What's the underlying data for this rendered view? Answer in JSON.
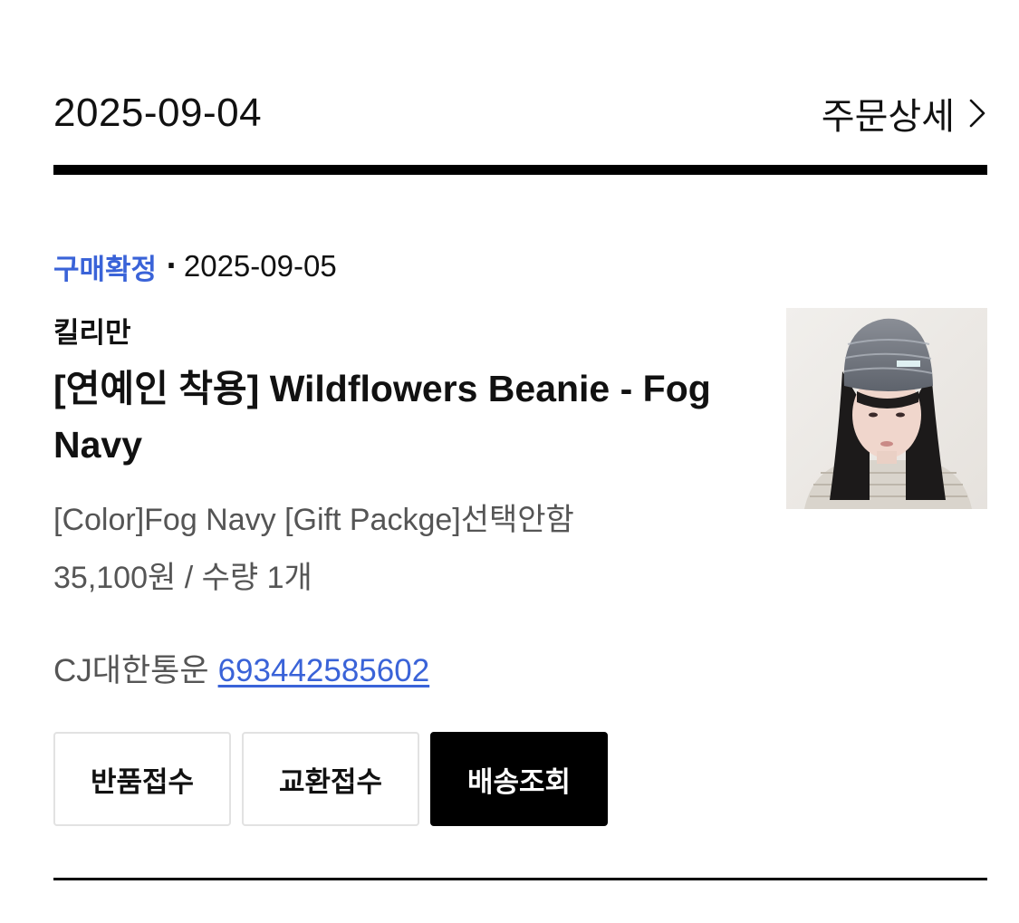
{
  "order": {
    "date": "2025-09-04",
    "detail_label": "주문상세"
  },
  "item": {
    "status": "구매확정",
    "status_separator": "·",
    "status_date": "2025-09-05",
    "brand": "킬리만",
    "name": "[연예인 착용] Wildflowers Beanie - Fog Navy",
    "options": "[Color]Fog Navy [Gift Packge]선택안함",
    "price_quantity": "35,100원 / 수량 1개",
    "courier": "CJ대한통운",
    "tracking_number": "693442585602"
  },
  "actions": {
    "return_label": "반품접수",
    "exchange_label": "교환접수",
    "tracking_label": "배송조회"
  },
  "icons": {
    "detail": "chevron-right-icon",
    "thumbnail": "product-thumbnail-beanie"
  },
  "colors": {
    "accent_blue": "#3a63d8",
    "text_primary": "#111111",
    "text_secondary": "#555555",
    "button_dark": "#000000"
  }
}
